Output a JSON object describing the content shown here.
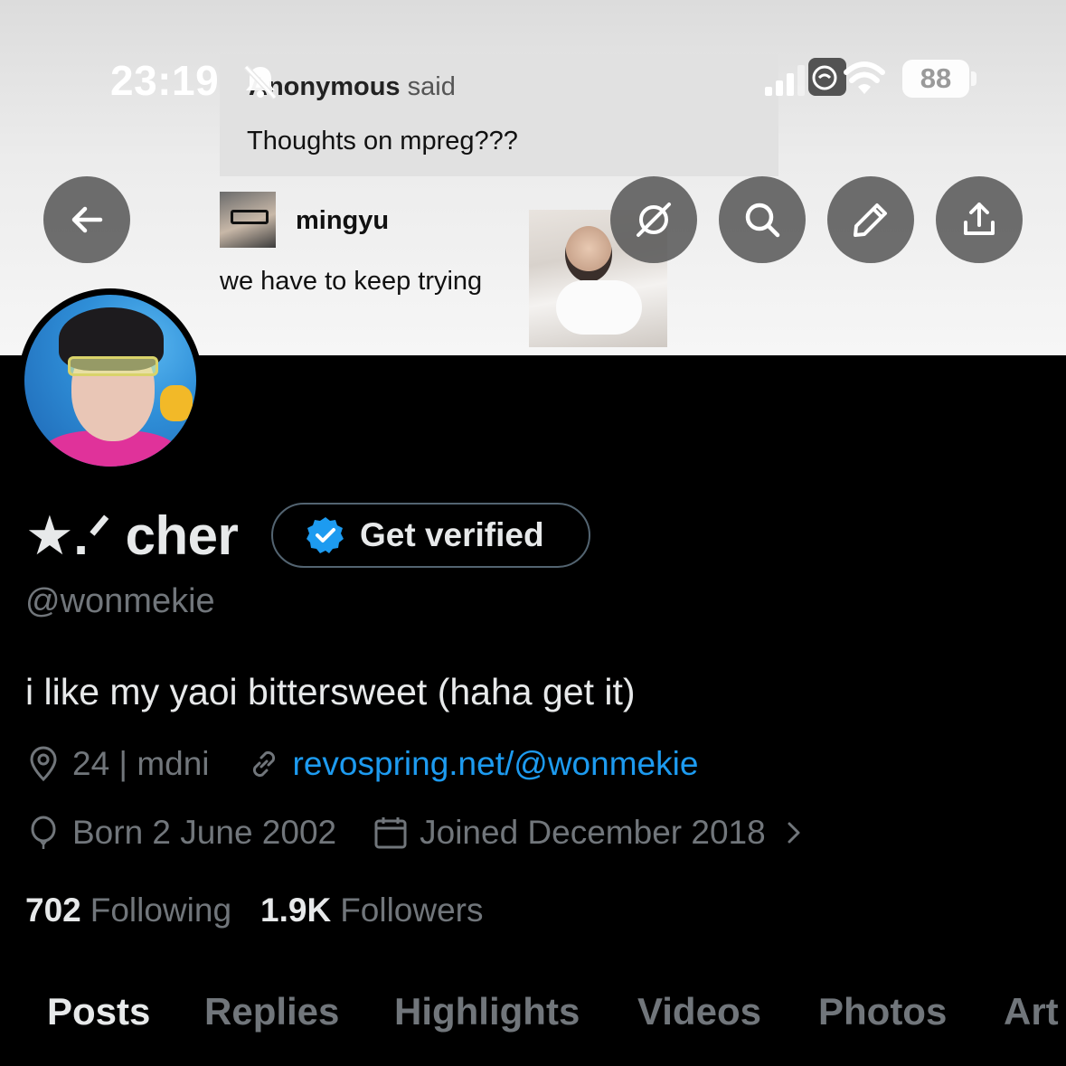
{
  "status_bar": {
    "time": "23:19",
    "battery": "88"
  },
  "banner": {
    "ask_prefix": "Anonymous",
    "ask_suffix": "said",
    "ask_question": "Thoughts on mpreg???",
    "reply_name": "mingyu",
    "reply_text": "we have to keep trying"
  },
  "header_buttons": {
    "back": "arrow-left-icon",
    "grok": "grok-icon",
    "search": "search-icon",
    "compose": "pencil-icon",
    "share": "share-icon"
  },
  "profile": {
    "display_name": "★.ᐟ cher",
    "get_verified_label": "Get verified",
    "handle": "@wonmekie",
    "bio": "i like my yaoi bittersweet (haha get it)",
    "location": "24 | mdni",
    "website": "revospring.net/@wonmekie",
    "birthday": "Born 2 June 2002",
    "joined": "Joined December 2018",
    "following_count": "702",
    "following_label": "Following",
    "followers_count": "1.9K",
    "followers_label": "Followers"
  },
  "tabs": [
    "Posts",
    "Replies",
    "Highlights",
    "Videos",
    "Photos",
    "Art"
  ],
  "colors": {
    "background": "#000000",
    "text_primary": "#e7e9ea",
    "text_secondary": "#71767b",
    "link": "#1d9bf0",
    "verified_badge": "#1d9bf0"
  }
}
